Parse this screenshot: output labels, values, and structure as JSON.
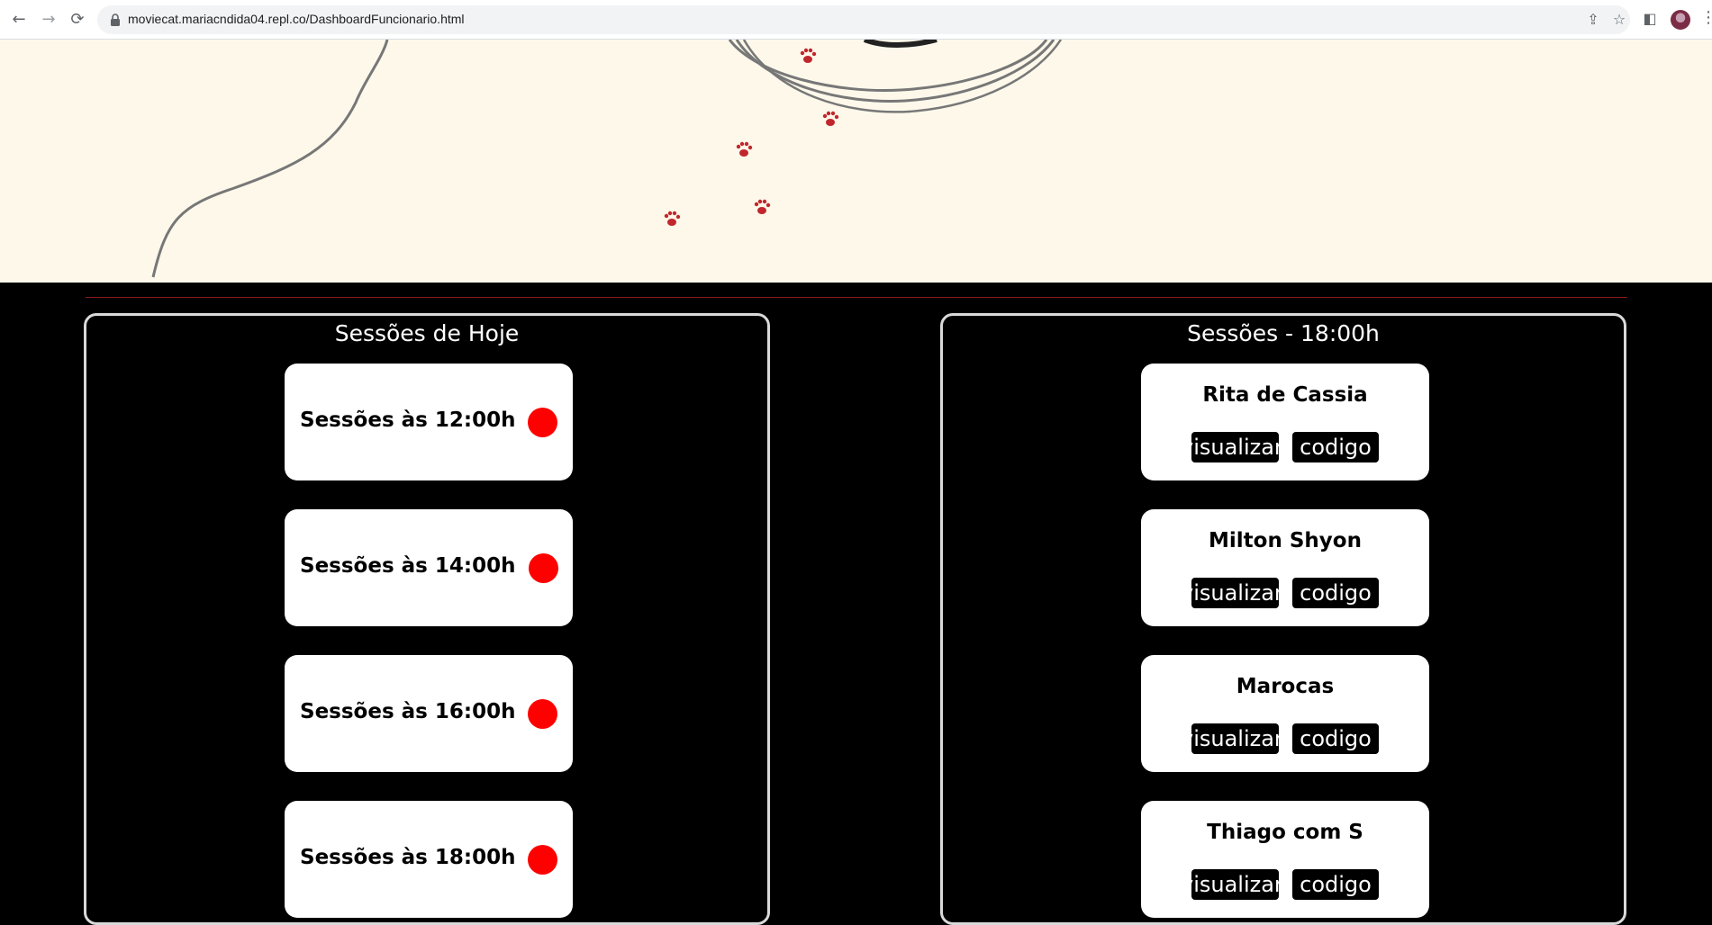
{
  "browser": {
    "url": "moviecat.mariacndida04.repl.co/DashboardFuncionario.html",
    "nav": {
      "back": "←",
      "forward": "→",
      "reload": "⟳"
    },
    "icons": [
      "share-icon",
      "star-icon",
      "sidebar-icon",
      "avatar",
      "menu-icon"
    ]
  },
  "sessions_panel": {
    "title": "Sessões de Hoje",
    "items": [
      {
        "label": "Sessões às 12:00h"
      },
      {
        "label": "Sessões às 14:00h"
      },
      {
        "label": "Sessões às 16:00h"
      },
      {
        "label": "Sessões às 18:00h"
      }
    ],
    "status_color": "#ff0000"
  },
  "clients_panel": {
    "title": "Sessões - 18:00h",
    "items": [
      {
        "name": "Rita de Cassia",
        "view_label": "visualizar",
        "code_label": "codigo"
      },
      {
        "name": "Milton Shyon",
        "view_label": "visualizar",
        "code_label": "codigo"
      },
      {
        "name": "Marocas",
        "view_label": "visualizar",
        "code_label": "codigo"
      },
      {
        "name": "Thiago com S",
        "view_label": "visualizar",
        "code_label": "codigo"
      }
    ]
  },
  "colors": {
    "page_background": "#000000",
    "hero_background": "#fdf8ea",
    "paw_prints": "#c0272d",
    "separator": "#8a1a1a",
    "panel_border": "#d9d9d9"
  }
}
